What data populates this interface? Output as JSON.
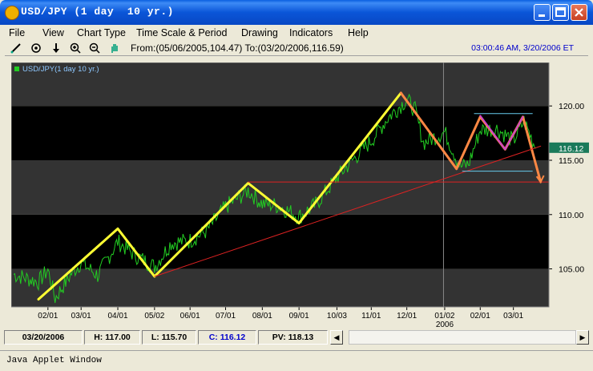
{
  "window": {
    "title": "USD/JPY (1 day  10 yr.)",
    "buttons": [
      "minimize",
      "maximize",
      "close"
    ]
  },
  "menu": [
    "File",
    "View",
    "Chart Type",
    "Time Scale & Period",
    "Drawing",
    "Indicators",
    "Help"
  ],
  "toolbar": {
    "icons": [
      "line-draw-icon",
      "crosshair-icon",
      "down-arrow-icon",
      "zoom-in-icon",
      "zoom-out-icon",
      "pan-hand-icon"
    ],
    "range_text": "From:(05/06/2005,104.47) To:(03/20/2006,116.59)",
    "timestamp": "03:00:46 AM, 3/20/2006 ET"
  },
  "status": {
    "date": "03/20/2006",
    "high": "H: 117.00",
    "low": "L: 115.70",
    "close": "C: 116.12",
    "pv": "PV: 118.13"
  },
  "applet_label": "Java Applet Window",
  "colors": {
    "price_line": "#22cc22",
    "trend_line": "#ffff33",
    "support_line": "#dd2222",
    "recent_trend": "#ff8844",
    "pattern_line": "#cc44cc",
    "channel_line": "#66ccee",
    "last_price_tag": "#1a7a5a"
  },
  "chart_data": {
    "type": "line",
    "legend": "USD/JPY(1 day  10 yr.)",
    "ylim": [
      101.5,
      124
    ],
    "yticks": [
      105,
      110,
      115,
      120
    ],
    "ytick_labels": [
      "105.00",
      "110.00",
      "115.00",
      "120.00"
    ],
    "xticks": [
      "02/01",
      "03/01",
      "04/01",
      "05/02",
      "06/01",
      "07/01",
      "08/01",
      "09/01",
      "10/03",
      "11/01",
      "12/01",
      "01/02",
      "02/01",
      "03/01"
    ],
    "x_year_label": "2006",
    "last_price": "116.12",
    "price_series": [
      {
        "date": "2005-01-03",
        "value": 104.5
      },
      {
        "date": "2005-01-24",
        "value": 103.8
      },
      {
        "date": "2005-02-01",
        "value": 104.9
      },
      {
        "date": "2005-02-07",
        "value": 102.3
      },
      {
        "date": "2005-02-21",
        "value": 104.6
      },
      {
        "date": "2005-03-01",
        "value": 105.6
      },
      {
        "date": "2005-03-15",
        "value": 104.4
      },
      {
        "date": "2005-04-01",
        "value": 107.5
      },
      {
        "date": "2005-04-15",
        "value": 106.3
      },
      {
        "date": "2005-05-02",
        "value": 105.2
      },
      {
        "date": "2005-05-16",
        "value": 107.4
      },
      {
        "date": "2005-06-01",
        "value": 107.6
      },
      {
        "date": "2005-06-15",
        "value": 108.5
      },
      {
        "date": "2005-07-01",
        "value": 110.7
      },
      {
        "date": "2005-07-20",
        "value": 112.2
      },
      {
        "date": "2005-08-01",
        "value": 111.0
      },
      {
        "date": "2005-08-15",
        "value": 110.8
      },
      {
        "date": "2005-09-01",
        "value": 109.8
      },
      {
        "date": "2005-09-15",
        "value": 110.9
      },
      {
        "date": "2005-10-03",
        "value": 113.4
      },
      {
        "date": "2005-10-17",
        "value": 115.1
      },
      {
        "date": "2005-11-01",
        "value": 116.8
      },
      {
        "date": "2005-11-15",
        "value": 118.9
      },
      {
        "date": "2005-12-01",
        "value": 120.6
      },
      {
        "date": "2005-12-08",
        "value": 119.6
      },
      {
        "date": "2005-12-15",
        "value": 116.6
      },
      {
        "date": "2006-01-02",
        "value": 117.6
      },
      {
        "date": "2006-01-15",
        "value": 114.4
      },
      {
        "date": "2006-01-22",
        "value": 114.6
      },
      {
        "date": "2006-02-01",
        "value": 117.8
      },
      {
        "date": "2006-02-15",
        "value": 117.9
      },
      {
        "date": "2006-03-01",
        "value": 116.8
      },
      {
        "date": "2006-03-10",
        "value": 118.6
      },
      {
        "date": "2006-03-20",
        "value": 116.1
      }
    ],
    "trend_lines": [
      {
        "name": "yellow-zigzag",
        "points": [
          {
            "date": "2005-01-24",
            "value": 102.2
          },
          {
            "date": "2005-04-01",
            "value": 108.7
          },
          {
            "date": "2005-05-02",
            "value": 104.3
          },
          {
            "date": "2005-07-20",
            "value": 112.9
          },
          {
            "date": "2005-09-01",
            "value": 109.2
          },
          {
            "date": "2005-11-26",
            "value": 121.2
          }
        ]
      },
      {
        "name": "orange-zigzag",
        "points": [
          {
            "date": "2005-11-26",
            "value": 121.2
          },
          {
            "date": "2006-01-12",
            "value": 114.2
          },
          {
            "date": "2006-02-01",
            "value": 119.0
          },
          {
            "date": "2006-02-22",
            "value": 116.0
          },
          {
            "date": "2006-03-09",
            "value": 119.0
          },
          {
            "date": "2006-03-24",
            "value": 113.0
          }
        ]
      },
      {
        "name": "magenta-pattern",
        "points": [
          {
            "date": "2006-02-01",
            "value": 119.1
          },
          {
            "date": "2006-02-22",
            "value": 116.0
          },
          {
            "date": "2006-03-09",
            "value": 119.0
          }
        ]
      },
      {
        "name": "red-support-trend",
        "points": [
          {
            "date": "2005-05-02",
            "value": 104.3
          },
          {
            "date": "2006-03-24",
            "value": 116.3
          }
        ]
      },
      {
        "name": "red-horizontal",
        "points": [
          {
            "date": "2005-07-20",
            "value": 113.0
          },
          {
            "date": "2006-03-31",
            "value": 113.0
          }
        ]
      },
      {
        "name": "cyan-upper",
        "points": [
          {
            "date": "2006-01-27",
            "value": 119.3
          },
          {
            "date": "2006-03-17",
            "value": 119.3
          }
        ]
      },
      {
        "name": "cyan-lower",
        "points": [
          {
            "date": "2006-01-17",
            "value": 114.0
          },
          {
            "date": "2006-03-17",
            "value": 114.0
          }
        ]
      }
    ]
  }
}
